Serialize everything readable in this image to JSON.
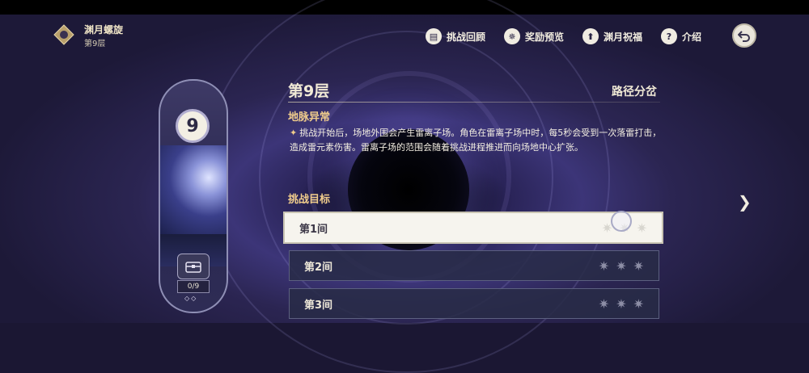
{
  "header": {
    "title": "渊月螺旋",
    "subtitle": "第9层",
    "logo_icon": "abyss-emblem-icon",
    "buttons": [
      {
        "label": "挑战回顾",
        "icon": "book-icon",
        "glyph": "▤"
      },
      {
        "label": "奖励预览",
        "icon": "gear-star-icon",
        "glyph": "✵"
      },
      {
        "label": "渊月祝福",
        "icon": "blessing-icon",
        "glyph": "⬆"
      },
      {
        "label": "介绍",
        "icon": "help-icon",
        "glyph": "?"
      }
    ],
    "back_icon": "back-icon"
  },
  "floor_card": {
    "floor_number": "9",
    "counter": "0/9",
    "diamonds": "◇◇"
  },
  "panel": {
    "floor_title": "第9层",
    "path_label": "路径分岔",
    "section_title": "地脉异常",
    "description": "挑战开始后，场地外围会产生雷离子场。角色在雷离子场中时，每5秒会受到一次落雷打击，造成雷元素伤害。雷离子场的范围会随着挑战进程推进而向场地中心扩张。",
    "goal_title": "挑战目标",
    "chambers": [
      {
        "label": "第1间",
        "selected": true
      },
      {
        "label": "第2间",
        "selected": false
      },
      {
        "label": "第3间",
        "selected": false
      }
    ]
  },
  "colors": {
    "accent_gold": "#f1cd8c",
    "panel_dark": "#282c46",
    "selected_row": "#f6f4ee"
  }
}
